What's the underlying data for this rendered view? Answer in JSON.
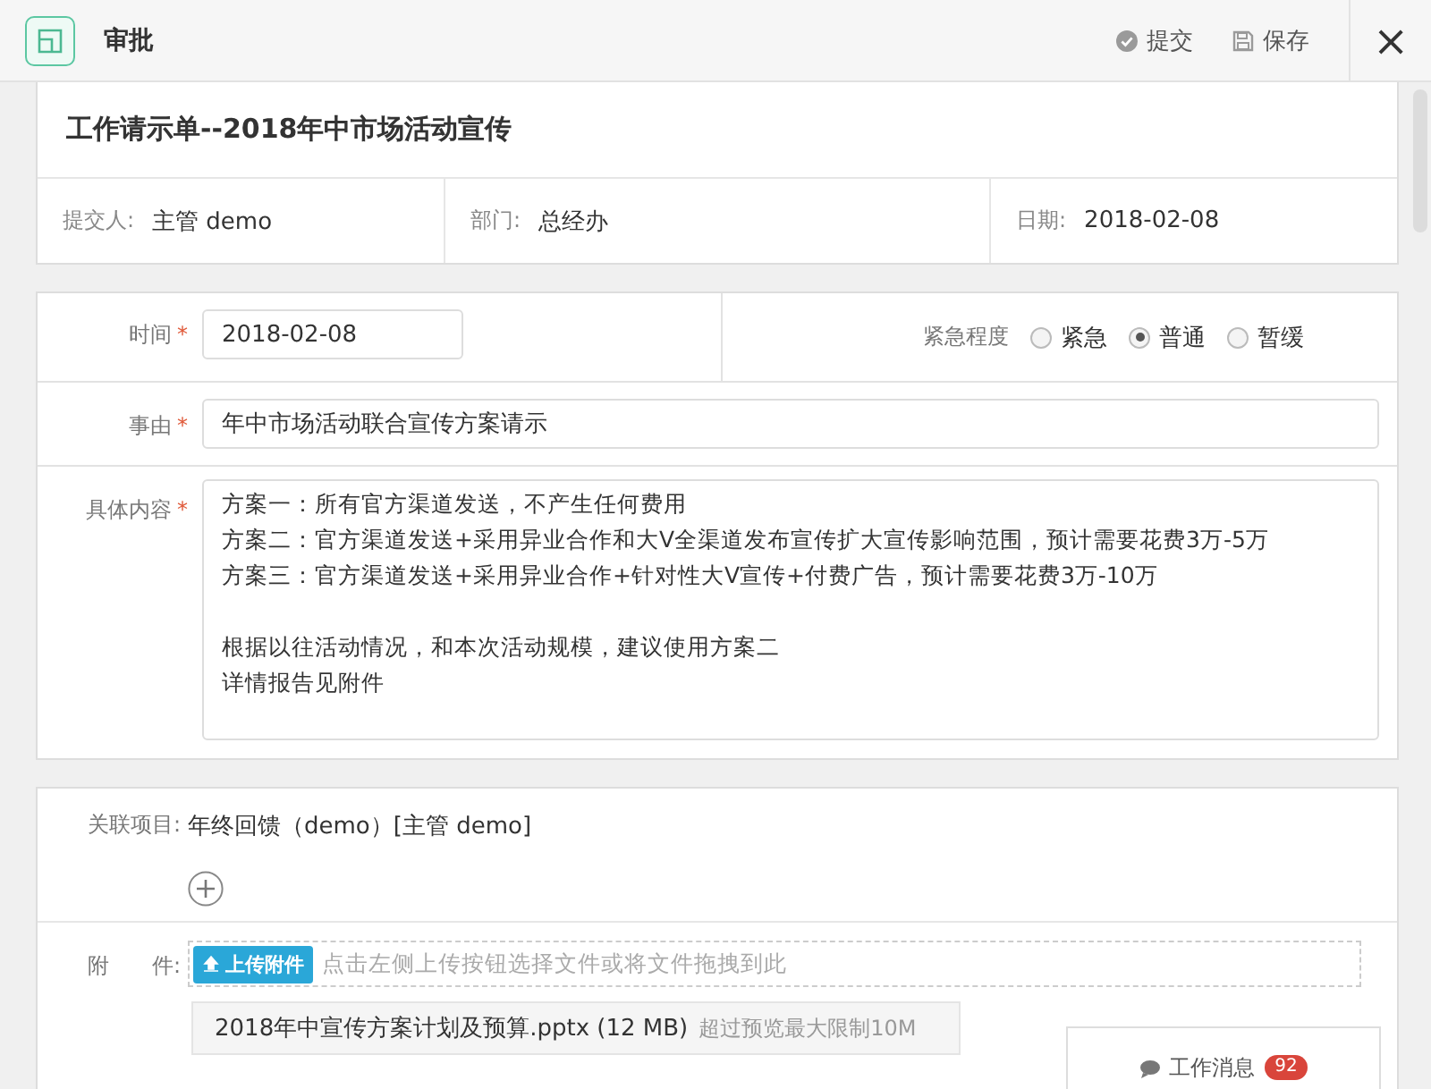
{
  "header": {
    "title": "审批",
    "actions": [
      {
        "kind": "submit",
        "label": "提交"
      },
      {
        "kind": "save",
        "label": "保存"
      }
    ],
    "close": "×"
  },
  "document": {
    "title": "工作请示单--2018年中市场活动宣传",
    "meta": [
      {
        "label": "提交人:",
        "value": "主管 demo"
      },
      {
        "label": "部门:",
        "value": "总经办"
      },
      {
        "label": "日期:",
        "value": "2018-02-08"
      }
    ]
  },
  "form": {
    "time": {
      "label": "时间",
      "required_mark": "*",
      "value": "2018-02-08"
    },
    "urgency": {
      "label": "紧急程度",
      "options": [
        {
          "label": "紧急",
          "selected": false
        },
        {
          "label": "普通",
          "selected": true
        },
        {
          "label": "暂缓",
          "selected": false
        }
      ]
    },
    "reason": {
      "label": "事由",
      "required_mark": "*",
      "value": "年中市场活动联合宣传方案请示"
    },
    "content": {
      "label": "具体内容",
      "required_mark": "*",
      "paragraphs": [
        {
          "lines": [
            "方案一：所有官方渠道发送，不产生任何费用",
            "方案二：官方渠道发送+采用异业合作和大V全渠道发布宣传扩大宣传影响范围，预计需要花费3万-5万",
            "方案三：官方渠道发送+采用异业合作+针对性大V宣传+付费广告，预计需要花费3万-10万"
          ]
        },
        {
          "lines": [
            "根据以往活动情况，和本次活动规模，建议使用方案二",
            "详情报告见附件"
          ]
        }
      ]
    }
  },
  "related": {
    "label": "关联项目:",
    "value": "年终回馈（demo）[主管 demo]"
  },
  "attachments": {
    "label": "附　　件:",
    "upload_button": "上传附件",
    "hint": "点击左侧上传按钮选择文件或将文件拖拽到此",
    "files": [
      {
        "name": "2018年中宣传方案计划及预算.pptx (12 MB)",
        "note": "超过预览最大限制10M"
      }
    ]
  },
  "messages": {
    "label": "工作消息",
    "count": "92"
  }
}
